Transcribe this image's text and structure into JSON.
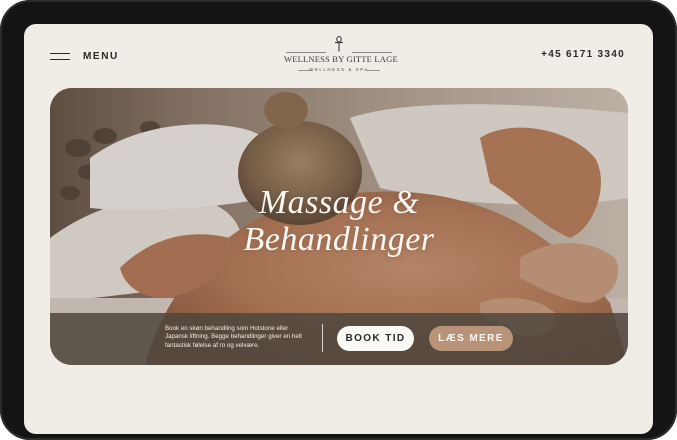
{
  "header": {
    "menu_label": "MENU",
    "phone": "+45 6171 3340",
    "logo": {
      "name": "WELLNESS BY GITTE LAGE",
      "tagline": "WELLNESS & SPA"
    }
  },
  "hero": {
    "title_line1": "Massage &",
    "title_line2": "Behandlinger",
    "description": "Book en skøn behandling som Hotstone eller Japansk liftning. Begge behandlinger giver en helt fantastisk følelse af ro og velvære.",
    "book_label": "BOOK TID",
    "more_label": "LÆS MERE"
  },
  "colors": {
    "page_background": "#f0ede7",
    "device_frame": "#141414",
    "text_dark": "#2a2a2a",
    "accent_button": "#b89378",
    "book_button": "#fbf9f5",
    "hero_bar": "#4e463e"
  },
  "icons": {
    "menu": "hamburger-icon",
    "logo_mark": "ankh-logo-icon"
  }
}
